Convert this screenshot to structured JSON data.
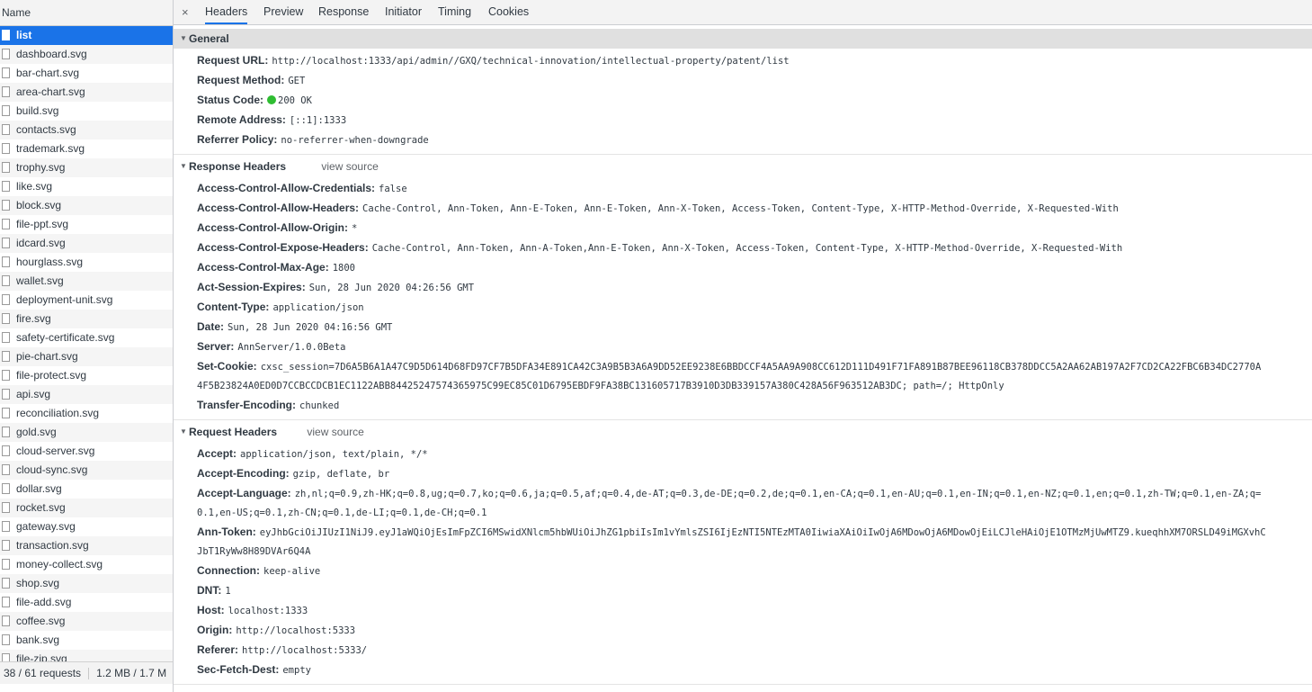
{
  "list": {
    "header": "Name",
    "items": [
      "list",
      "dashboard.svg",
      "bar-chart.svg",
      "area-chart.svg",
      "build.svg",
      "contacts.svg",
      "trademark.svg",
      "trophy.svg",
      "like.svg",
      "block.svg",
      "file-ppt.svg",
      "idcard.svg",
      "hourglass.svg",
      "wallet.svg",
      "deployment-unit.svg",
      "fire.svg",
      "safety-certificate.svg",
      "pie-chart.svg",
      "file-protect.svg",
      "api.svg",
      "reconciliation.svg",
      "gold.svg",
      "cloud-server.svg",
      "cloud-sync.svg",
      "dollar.svg",
      "rocket.svg",
      "gateway.svg",
      "transaction.svg",
      "money-collect.svg",
      "shop.svg",
      "file-add.svg",
      "coffee.svg",
      "bank.svg",
      "file-zip.svg"
    ],
    "status_requests": "38 / 61 requests",
    "status_size": "1.2 MB / 1.7 M"
  },
  "tabs": {
    "close": "×",
    "items": [
      "Headers",
      "Preview",
      "Response",
      "Initiator",
      "Timing",
      "Cookies"
    ]
  },
  "general": {
    "title": "General",
    "rows": [
      {
        "k": "Request URL:",
        "v": "http://localhost:1333/api/admin//GXQ/technical-innovation/intellectual-property/patent/list"
      },
      {
        "k": "Request Method:",
        "v": "GET"
      },
      {
        "k": "Status Code:",
        "v": "200 OK"
      },
      {
        "k": "Remote Address:",
        "v": "[::1]:1333"
      },
      {
        "k": "Referrer Policy:",
        "v": "no-referrer-when-downgrade"
      }
    ]
  },
  "response_headers": {
    "title": "Response Headers",
    "view_source": "view source",
    "rows": [
      {
        "k": "Access-Control-Allow-Credentials:",
        "v": "false"
      },
      {
        "k": "Access-Control-Allow-Headers:",
        "v": "Cache-Control, Ann-Token, Ann-E-Token, Ann-E-Token, Ann-X-Token, Access-Token, Content-Type, X-HTTP-Method-Override, X-Requested-With"
      },
      {
        "k": "Access-Control-Allow-Origin:",
        "v": "*"
      },
      {
        "k": "Access-Control-Expose-Headers:",
        "v": "Cache-Control, Ann-Token, Ann-A-Token,Ann-E-Token, Ann-X-Token, Access-Token, Content-Type, X-HTTP-Method-Override, X-Requested-With"
      },
      {
        "k": "Access-Control-Max-Age:",
        "v": "1800"
      },
      {
        "k": "Act-Session-Expires:",
        "v": "Sun, 28 Jun 2020 04:26:56 GMT"
      },
      {
        "k": "Content-Type:",
        "v": "application/json"
      },
      {
        "k": "Date:",
        "v": "Sun, 28 Jun 2020 04:16:56 GMT"
      },
      {
        "k": "Server:",
        "v": "AnnServer/1.0.0Beta"
      },
      {
        "k": "Set-Cookie:",
        "v": "cxsc_session=7D6A5B6A1A47C9D5D614D68FD97CF7B5DFA34E891CA42C3A9B5B3A6A9DD52EE9238E6BBDCCF4A5AA9A908CC612D111D491F71FA891B87BEE96118CB378DDCC5A2AA62AB197A2F7CD2CA22FBC6B34DC2770A"
      },
      {
        "k": "",
        "v": "4F5B23824A0ED0D7CCBCCDCB1EC1122ABB84425247574365975C99EC85C01D6795EBDF9FA38BC131605717B3910D3DB339157A380C428A56F963512AB3DC; path=/; HttpOnly"
      },
      {
        "k": "Transfer-Encoding:",
        "v": "chunked"
      }
    ]
  },
  "request_headers": {
    "title": "Request Headers",
    "view_source": "view source",
    "rows": [
      {
        "k": "Accept:",
        "v": "application/json, text/plain, */*"
      },
      {
        "k": "Accept-Encoding:",
        "v": "gzip, deflate, br"
      },
      {
        "k": "Accept-Language:",
        "v": "zh,nl;q=0.9,zh-HK;q=0.8,ug;q=0.7,ko;q=0.6,ja;q=0.5,af;q=0.4,de-AT;q=0.3,de-DE;q=0.2,de;q=0.1,en-CA;q=0.1,en-AU;q=0.1,en-IN;q=0.1,en-NZ;q=0.1,en;q=0.1,zh-TW;q=0.1,en-ZA;q="
      },
      {
        "k": "",
        "v": "0.1,en-US;q=0.1,zh-CN;q=0.1,de-LI;q=0.1,de-CH;q=0.1"
      },
      {
        "k": "Ann-Token:",
        "v": "eyJhbGciOiJIUzI1NiJ9.eyJ1aWQiOjEsImFpZCI6MSwidXNlcm5hbWUiOiJhZG1pbiIsIm1vYmlsZSI6IjEzNTI5NTEzMTA0IiwiaXAiOiIwOjA6MDowOjA6MDowOjEiLCJleHAiOjE1OTMzMjUwMTZ9.kueqhhXM7ORSLD49iMGXvhC"
      },
      {
        "k": "",
        "v": "JbT1RyWw8H89DVAr6Q4A"
      },
      {
        "k": "Connection:",
        "v": "keep-alive"
      },
      {
        "k": "DNT:",
        "v": "1"
      },
      {
        "k": "Host:",
        "v": "localhost:1333"
      },
      {
        "k": "Origin:",
        "v": "http://localhost:5333"
      },
      {
        "k": "Referer:",
        "v": "http://localhost:5333/"
      },
      {
        "k": "Sec-Fetch-Dest:",
        "v": "empty"
      }
    ]
  },
  "colors": {
    "accent": "#1a73e8",
    "status_ok": "#2fbd32"
  }
}
